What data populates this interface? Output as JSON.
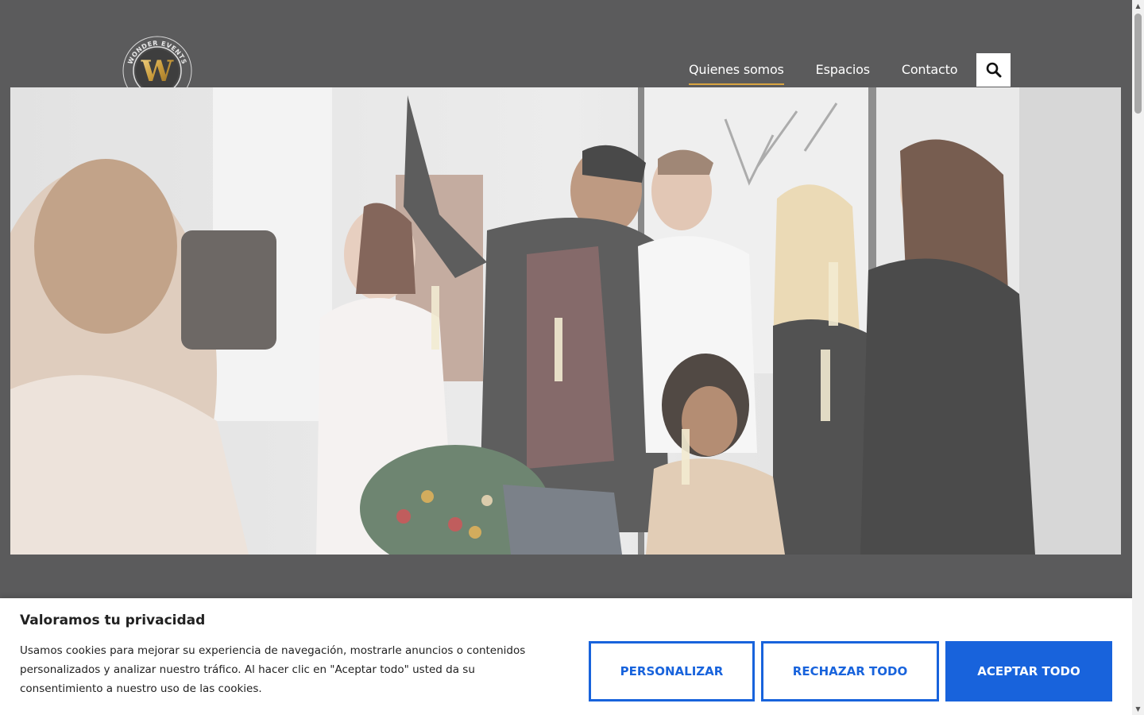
{
  "header": {
    "logo_text": "WONDER EVENTS",
    "logo_letter": "W",
    "nav": [
      {
        "label": "Quienes somos",
        "active": true
      },
      {
        "label": "Espacios",
        "active": false
      },
      {
        "label": "Contacto",
        "active": false
      }
    ],
    "search_icon": "search-icon"
  },
  "cookie_banner": {
    "title": "Valoramos tu privacidad",
    "text": "Usamos cookies para mejorar su experiencia de navegación, mostrarle anuncios o contenidos personalizados y analizar nuestro tráfico. Al hacer clic en \"Aceptar todo\" usted da su consentimiento a nuestro uso de las cookies.",
    "buttons": {
      "customize": "PERSONALIZAR",
      "reject": "RECHAZAR TODO",
      "accept": "ACEPTAR TODO"
    }
  },
  "colors": {
    "accent": "#d9a441",
    "primary_button": "#1863dc",
    "overlay": "#5b5b5c"
  }
}
